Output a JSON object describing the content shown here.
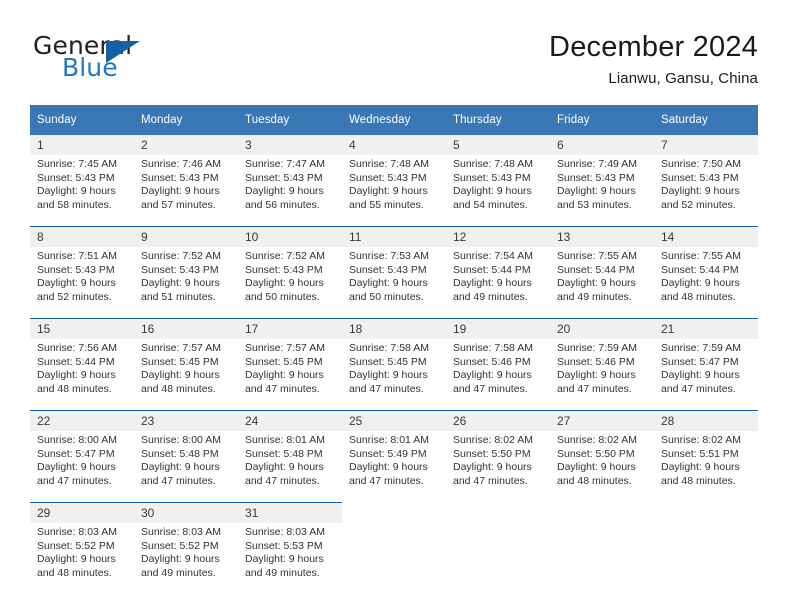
{
  "brand": {
    "line1": "General",
    "line2": "Blue",
    "triangle_color": "#1462a5",
    "blue_color": "#1f78c1"
  },
  "header": {
    "title": "December 2024",
    "location": "Lianwu, Gansu, China"
  },
  "calendar": {
    "header_bg": "#3a78b5",
    "daynum_bg": "#f0f0f0",
    "separator_color": "#1462a5",
    "weekday_headers": [
      "Sunday",
      "Monday",
      "Tuesday",
      "Wednesday",
      "Thursday",
      "Friday",
      "Saturday"
    ],
    "weeks": [
      [
        {
          "day": "1",
          "sunrise": "Sunrise: 7:45 AM",
          "sunset": "Sunset: 5:43 PM",
          "daylight1": "Daylight: 9 hours",
          "daylight2": "and 58 minutes."
        },
        {
          "day": "2",
          "sunrise": "Sunrise: 7:46 AM",
          "sunset": "Sunset: 5:43 PM",
          "daylight1": "Daylight: 9 hours",
          "daylight2": "and 57 minutes."
        },
        {
          "day": "3",
          "sunrise": "Sunrise: 7:47 AM",
          "sunset": "Sunset: 5:43 PM",
          "daylight1": "Daylight: 9 hours",
          "daylight2": "and 56 minutes."
        },
        {
          "day": "4",
          "sunrise": "Sunrise: 7:48 AM",
          "sunset": "Sunset: 5:43 PM",
          "daylight1": "Daylight: 9 hours",
          "daylight2": "and 55 minutes."
        },
        {
          "day": "5",
          "sunrise": "Sunrise: 7:48 AM",
          "sunset": "Sunset: 5:43 PM",
          "daylight1": "Daylight: 9 hours",
          "daylight2": "and 54 minutes."
        },
        {
          "day": "6",
          "sunrise": "Sunrise: 7:49 AM",
          "sunset": "Sunset: 5:43 PM",
          "daylight1": "Daylight: 9 hours",
          "daylight2": "and 53 minutes."
        },
        {
          "day": "7",
          "sunrise": "Sunrise: 7:50 AM",
          "sunset": "Sunset: 5:43 PM",
          "daylight1": "Daylight: 9 hours",
          "daylight2": "and 52 minutes."
        }
      ],
      [
        {
          "day": "8",
          "sunrise": "Sunrise: 7:51 AM",
          "sunset": "Sunset: 5:43 PM",
          "daylight1": "Daylight: 9 hours",
          "daylight2": "and 52 minutes."
        },
        {
          "day": "9",
          "sunrise": "Sunrise: 7:52 AM",
          "sunset": "Sunset: 5:43 PM",
          "daylight1": "Daylight: 9 hours",
          "daylight2": "and 51 minutes."
        },
        {
          "day": "10",
          "sunrise": "Sunrise: 7:52 AM",
          "sunset": "Sunset: 5:43 PM",
          "daylight1": "Daylight: 9 hours",
          "daylight2": "and 50 minutes."
        },
        {
          "day": "11",
          "sunrise": "Sunrise: 7:53 AM",
          "sunset": "Sunset: 5:43 PM",
          "daylight1": "Daylight: 9 hours",
          "daylight2": "and 50 minutes."
        },
        {
          "day": "12",
          "sunrise": "Sunrise: 7:54 AM",
          "sunset": "Sunset: 5:44 PM",
          "daylight1": "Daylight: 9 hours",
          "daylight2": "and 49 minutes."
        },
        {
          "day": "13",
          "sunrise": "Sunrise: 7:55 AM",
          "sunset": "Sunset: 5:44 PM",
          "daylight1": "Daylight: 9 hours",
          "daylight2": "and 49 minutes."
        },
        {
          "day": "14",
          "sunrise": "Sunrise: 7:55 AM",
          "sunset": "Sunset: 5:44 PM",
          "daylight1": "Daylight: 9 hours",
          "daylight2": "and 48 minutes."
        }
      ],
      [
        {
          "day": "15",
          "sunrise": "Sunrise: 7:56 AM",
          "sunset": "Sunset: 5:44 PM",
          "daylight1": "Daylight: 9 hours",
          "daylight2": "and 48 minutes."
        },
        {
          "day": "16",
          "sunrise": "Sunrise: 7:57 AM",
          "sunset": "Sunset: 5:45 PM",
          "daylight1": "Daylight: 9 hours",
          "daylight2": "and 48 minutes."
        },
        {
          "day": "17",
          "sunrise": "Sunrise: 7:57 AM",
          "sunset": "Sunset: 5:45 PM",
          "daylight1": "Daylight: 9 hours",
          "daylight2": "and 47 minutes."
        },
        {
          "day": "18",
          "sunrise": "Sunrise: 7:58 AM",
          "sunset": "Sunset: 5:45 PM",
          "daylight1": "Daylight: 9 hours",
          "daylight2": "and 47 minutes."
        },
        {
          "day": "19",
          "sunrise": "Sunrise: 7:58 AM",
          "sunset": "Sunset: 5:46 PM",
          "daylight1": "Daylight: 9 hours",
          "daylight2": "and 47 minutes."
        },
        {
          "day": "20",
          "sunrise": "Sunrise: 7:59 AM",
          "sunset": "Sunset: 5:46 PM",
          "daylight1": "Daylight: 9 hours",
          "daylight2": "and 47 minutes."
        },
        {
          "day": "21",
          "sunrise": "Sunrise: 7:59 AM",
          "sunset": "Sunset: 5:47 PM",
          "daylight1": "Daylight: 9 hours",
          "daylight2": "and 47 minutes."
        }
      ],
      [
        {
          "day": "22",
          "sunrise": "Sunrise: 8:00 AM",
          "sunset": "Sunset: 5:47 PM",
          "daylight1": "Daylight: 9 hours",
          "daylight2": "and 47 minutes."
        },
        {
          "day": "23",
          "sunrise": "Sunrise: 8:00 AM",
          "sunset": "Sunset: 5:48 PM",
          "daylight1": "Daylight: 9 hours",
          "daylight2": "and 47 minutes."
        },
        {
          "day": "24",
          "sunrise": "Sunrise: 8:01 AM",
          "sunset": "Sunset: 5:48 PM",
          "daylight1": "Daylight: 9 hours",
          "daylight2": "and 47 minutes."
        },
        {
          "day": "25",
          "sunrise": "Sunrise: 8:01 AM",
          "sunset": "Sunset: 5:49 PM",
          "daylight1": "Daylight: 9 hours",
          "daylight2": "and 47 minutes."
        },
        {
          "day": "26",
          "sunrise": "Sunrise: 8:02 AM",
          "sunset": "Sunset: 5:50 PM",
          "daylight1": "Daylight: 9 hours",
          "daylight2": "and 47 minutes."
        },
        {
          "day": "27",
          "sunrise": "Sunrise: 8:02 AM",
          "sunset": "Sunset: 5:50 PM",
          "daylight1": "Daylight: 9 hours",
          "daylight2": "and 48 minutes."
        },
        {
          "day": "28",
          "sunrise": "Sunrise: 8:02 AM",
          "sunset": "Sunset: 5:51 PM",
          "daylight1": "Daylight: 9 hours",
          "daylight2": "and 48 minutes."
        }
      ],
      [
        {
          "day": "29",
          "sunrise": "Sunrise: 8:03 AM",
          "sunset": "Sunset: 5:52 PM",
          "daylight1": "Daylight: 9 hours",
          "daylight2": "and 48 minutes."
        },
        {
          "day": "30",
          "sunrise": "Sunrise: 8:03 AM",
          "sunset": "Sunset: 5:52 PM",
          "daylight1": "Daylight: 9 hours",
          "daylight2": "and 49 minutes."
        },
        {
          "day": "31",
          "sunrise": "Sunrise: 8:03 AM",
          "sunset": "Sunset: 5:53 PM",
          "daylight1": "Daylight: 9 hours",
          "daylight2": "and 49 minutes."
        },
        {
          "day": "",
          "sunrise": "",
          "sunset": "",
          "daylight1": "",
          "daylight2": ""
        },
        {
          "day": "",
          "sunrise": "",
          "sunset": "",
          "daylight1": "",
          "daylight2": ""
        },
        {
          "day": "",
          "sunrise": "",
          "sunset": "",
          "daylight1": "",
          "daylight2": ""
        },
        {
          "day": "",
          "sunrise": "",
          "sunset": "",
          "daylight1": "",
          "daylight2": ""
        }
      ]
    ]
  }
}
